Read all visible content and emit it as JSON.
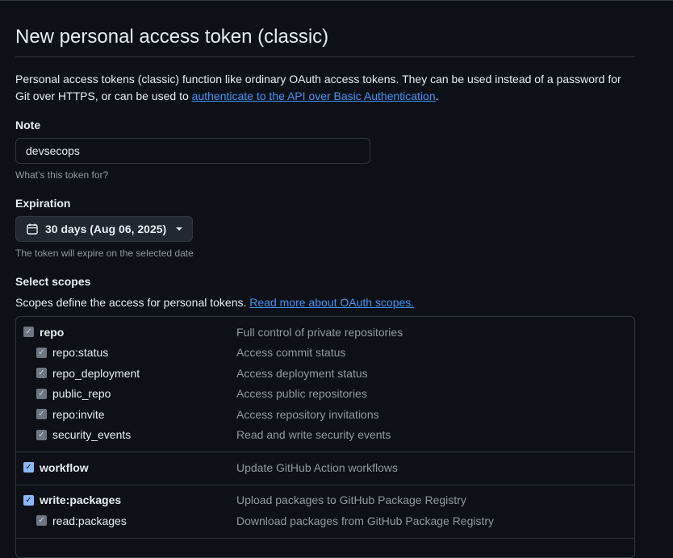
{
  "title": "New personal access token (classic)",
  "intro": {
    "text": "Personal access tokens (classic) function like ordinary OAuth access tokens. They can be used instead of a password for Git over HTTPS, or can be used to ",
    "link": "authenticate to the API over Basic Authentication",
    "end": "."
  },
  "note": {
    "label": "Note",
    "value": "devsecops",
    "hint": "What’s this token for?"
  },
  "expiration": {
    "label": "Expiration",
    "value": "30 days (Aug 06, 2025)",
    "hint": "The token will expire on the selected date"
  },
  "scopes": {
    "label": "Select scopes",
    "desc": "Scopes define the access for personal tokens. ",
    "link": "Read more about OAuth scopes.",
    "groups": [
      {
        "name": "repo",
        "desc": "Full control of private repositories",
        "checked": true,
        "enabled": false,
        "children": [
          {
            "name": "repo:status",
            "desc": "Access commit status"
          },
          {
            "name": "repo_deployment",
            "desc": "Access deployment status"
          },
          {
            "name": "public_repo",
            "desc": "Access public repositories"
          },
          {
            "name": "repo:invite",
            "desc": "Access repository invitations"
          },
          {
            "name": "security_events",
            "desc": "Read and write security events"
          }
        ]
      },
      {
        "name": "workflow",
        "desc": "Update GitHub Action workflows",
        "checked": true,
        "enabled": true,
        "children": []
      },
      {
        "name": "write:packages",
        "desc": "Upload packages to GitHub Package Registry",
        "checked": true,
        "enabled": true,
        "children": [
          {
            "name": "read:packages",
            "desc": "Download packages from GitHub Package Registry"
          }
        ]
      }
    ]
  }
}
